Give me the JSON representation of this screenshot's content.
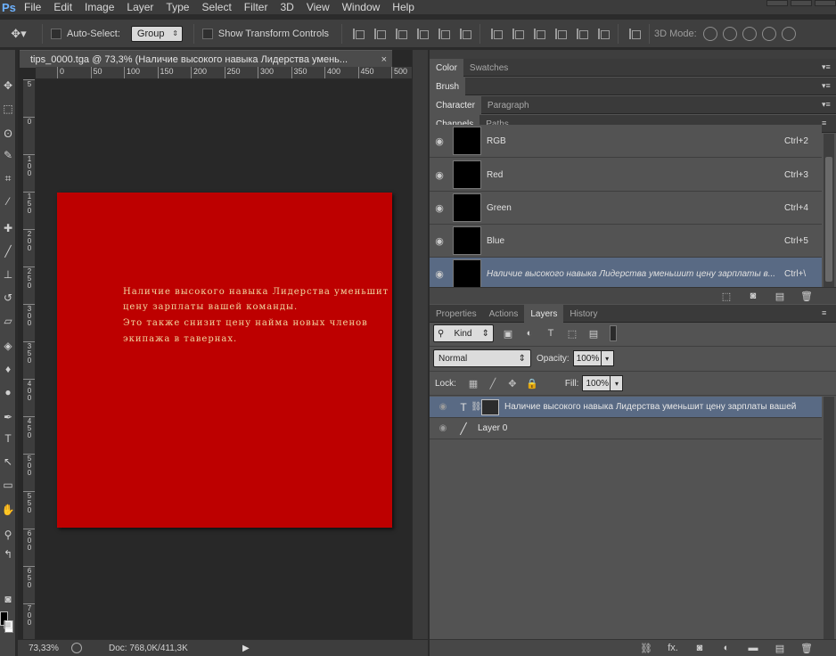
{
  "app": {
    "logo": "Ps"
  },
  "menu": [
    "File",
    "Edit",
    "Image",
    "Layer",
    "Type",
    "Select",
    "Filter",
    "3D",
    "View",
    "Window",
    "Help"
  ],
  "options": {
    "tool_icon": "move-tool-icon",
    "auto_select_label": "Auto-Select:",
    "auto_select_value": "Group",
    "show_transform_label": "Show Transform Controls",
    "mode3d_label": "3D Mode:"
  },
  "document": {
    "tab_title": "tips_0000.tga @ 73,3% (Наличие высокого навыка Лидерства умень...",
    "tab_close": "×",
    "ruler_h": [
      "0",
      "50",
      "100",
      "150",
      "200",
      "250",
      "300",
      "350",
      "400",
      "450",
      "500"
    ],
    "ruler_v": [
      "5",
      "0",
      "1\n0\n0",
      "1\n5\n0",
      "2\n0\n0",
      "2\n5\n0",
      "3\n0\n0",
      "3\n5\n0",
      "4\n0\n0",
      "4\n5\n0",
      "5\n0\n0",
      "5\n5\n0",
      "6\n0\n0",
      "6\n5\n0",
      "7\n0\n0"
    ],
    "canvas_color": "#bd0000",
    "text_color": "#f1d7a0",
    "text_lines": [
      "Наличие высокого навыка Лидерства уменьшит",
      "цену зарплаты вашей команды.",
      "Это также снизит цену найма новых членов",
      "экипажа в тавернах."
    ]
  },
  "status": {
    "zoom": "73,33%",
    "doc": "Doc: 768,0K/411,3K",
    "play": "▶"
  },
  "panels": {
    "group1_tabs": [
      "Color",
      "Swatches"
    ],
    "group2_tabs": [
      "Brush"
    ],
    "group3_tabs": [
      "Character",
      "Paragraph"
    ],
    "group4_tabs": [
      "Channels",
      "Paths"
    ],
    "channels": [
      {
        "name": "RGB",
        "shortcut": "Ctrl+2"
      },
      {
        "name": "Red",
        "shortcut": "Ctrl+3"
      },
      {
        "name": "Green",
        "shortcut": "Ctrl+4"
      },
      {
        "name": "Blue",
        "shortcut": "Ctrl+5"
      },
      {
        "name": "Наличие высокого навыка Лидерства уменьшит цену зарплаты в...",
        "shortcut": "Ctrl+\\"
      }
    ],
    "group5_tabs": [
      "Properties",
      "Actions",
      "Layers",
      "History"
    ],
    "layers": {
      "kind_label": "Kind",
      "blend_mode": "Normal",
      "opacity_label": "Opacity:",
      "opacity_value": "100%",
      "lock_label": "Lock:",
      "fill_label": "Fill:",
      "fill_value": "100%",
      "items": [
        {
          "type_icon": "T",
          "name": "Наличие высокого навыка Лидерства уменьшит цену зарплаты вашей"
        },
        {
          "type_icon": "brush",
          "name": "Layer 0"
        }
      ],
      "footer_fx": "fx."
    }
  },
  "colors": {
    "selected_row": "#596a84",
    "accent_logo": "#6db2ff"
  }
}
